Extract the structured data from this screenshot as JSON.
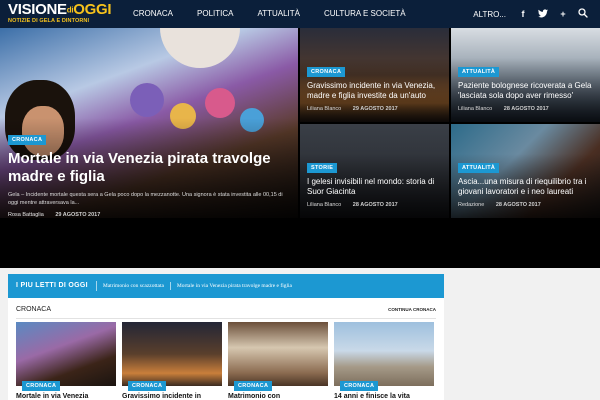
{
  "nav": {
    "logo_visione": "VISIONE",
    "logo_di": "di",
    "logo_oggi": "OGGI",
    "logo_tagline": "NOTIZIE DI GELA E DINTORNI",
    "items": [
      "CRONACA",
      "POLITICA",
      "ATTUALITÀ",
      "CULTURA E SOCIETÀ"
    ],
    "altro": "ALTRO...",
    "icons": [
      "facebook-icon",
      "twitter-icon",
      "plus-icon",
      "search-icon"
    ]
  },
  "hero": {
    "main": {
      "category": "CRONACA",
      "title": "Mortale in via Venezia pirata travolge madre e figlia",
      "excerpt": "Gela – Incidente mortale questa sera a Gela poco dopo la mezzanotte. Una signora è stata investita alle 00,15 di oggi mentre attraversava la...",
      "author": "Rosa Battaglia",
      "date": "29 AGOSTO 2017"
    },
    "tiles": [
      {
        "category": "CRONACA",
        "title": "Gravissimo incidente in via Venezia, madre e figlia investite da un'auto",
        "author": "Liliana Blanco",
        "date": "29 AGOSTO 2017"
      },
      {
        "category": "ATTUALITÀ",
        "title": "Paziente bolognese ricoverata a Gela 'lasciata sola dopo aver rimesso'",
        "author": "Liliana Blanco",
        "date": "28 AGOSTO 2017"
      },
      {
        "category": "STORIE",
        "title": "I gelesi invisibili nel mondo: storia di Suor Giacinta",
        "author": "Liliana Blanco",
        "date": "28 AGOSTO 2017"
      },
      {
        "category": "ATTUALITÀ",
        "title": "Ascia...una misura di riequilibrio tra i giovani lavoratori e i neo laureati",
        "author": "Redazione",
        "date": "28 AGOSTO 2017"
      }
    ]
  },
  "most_read": {
    "label": "I PIU LETTI DI OGGI",
    "items": [
      "Matrimonio con scazzottata",
      "Mortale in via Venezia pirata travolge madre e figlia"
    ]
  },
  "section": {
    "title": "CRONACA",
    "more": "CONTINUA CRONACA",
    "cards": [
      {
        "category": "CRONACA",
        "title": "Mortale in via Venezia"
      },
      {
        "category": "CRONACA",
        "title": "Gravissimo incidente in"
      },
      {
        "category": "CRONACA",
        "title": "Matrimonio con"
      },
      {
        "category": "CRONACA",
        "title": "14 anni e finisce la vita"
      }
    ]
  },
  "colors": {
    "nav_bg": "#0b1f3a",
    "accent": "#1c98d2",
    "logo_yellow": "#f6c21c"
  }
}
